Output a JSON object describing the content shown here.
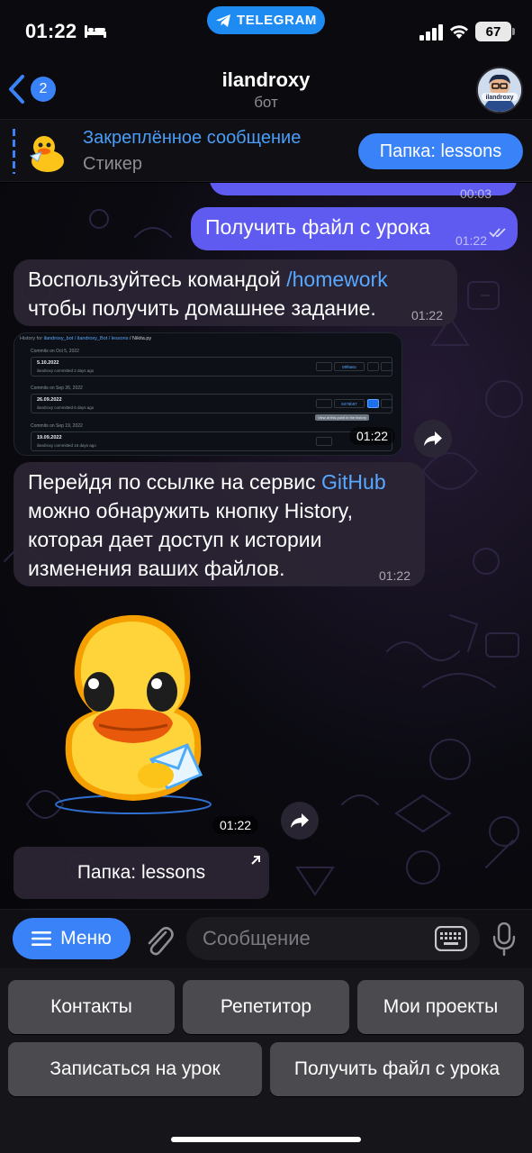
{
  "status": {
    "time": "01:22",
    "app_pill": "TELEGRAM",
    "battery": "67"
  },
  "header": {
    "back_count": "2",
    "title": "ilandroxy",
    "subtitle": "бот",
    "avatar_text": "ilandroxy"
  },
  "pinned": {
    "title": "Закреплённое сообщение",
    "subtitle": "Стикер",
    "button": "Папка: lessons"
  },
  "messages": {
    "out_partial_time": "00:03",
    "out_text": "Получить файл с урока",
    "out_time": "01:22",
    "in1_text_a": "Воспользуйтесь командой ",
    "in1_link": "/homework",
    "in1_text_b": "чтобы получить домашнее задание.",
    "in1_time": "01:22",
    "screenshot": {
      "breadcrumb_prefix": "History for ",
      "breadcrumb_path": "ilandroxy_bot / ilandroxy_Bot / lessons",
      "breadcrumb_file": " / Nikita.py",
      "groups": [
        {
          "header": "Commits on Oct 5, 2022",
          "title": "5.10.2022",
          "meta": "ilandroxy committed 2 days ago",
          "sha": "09f9a6c"
        },
        {
          "header": "Commits on Sep 26, 2022",
          "title": "26.09.2022",
          "meta": "ilandroxy committed 6 days ago",
          "sha": "8476b97"
        },
        {
          "header": "Commits on Sep 19, 2022",
          "title": "19.09.2022",
          "meta": "ilandroxy committed 16 days ago",
          "sha": "4e1b2f0"
        }
      ],
      "tooltip": "View at this point in the history",
      "time": "01:22"
    },
    "in2_text_a": "Перейдя по ссылке на сервис ",
    "in2_link": "GitHub",
    "in2_text_b": "можно обнаружить кнопку History, которая дает доступ к истории изменения ваших файлов.",
    "in2_time": "01:22",
    "sticker_time": "01:22",
    "inline_button": "Папка: lessons"
  },
  "composer": {
    "menu_label": "Меню",
    "placeholder": "Сообщение"
  },
  "keyboard": {
    "row1": [
      "Контакты",
      "Репетитор",
      "Мои проекты"
    ],
    "row2": [
      "Записаться на урок",
      "Получить файл с урока"
    ]
  },
  "colors": {
    "accent": "#3a82f7",
    "outgoing_bubble": "#5f5bf0",
    "incoming_bubble": "#2b2434",
    "link": "#59a8ff",
    "telegram_pill": "#1d8bf1",
    "keyboard_button": "#4a4a4f"
  },
  "icons": [
    "bed-icon",
    "telegram-icon",
    "signal-icon",
    "wifi-icon",
    "battery-icon",
    "back-chevron-icon",
    "duck-sticker-icon",
    "forward-icon",
    "external-link-icon",
    "menu-icon",
    "attach-icon",
    "keyboard-icon",
    "mic-icon",
    "double-check-icon"
  ]
}
